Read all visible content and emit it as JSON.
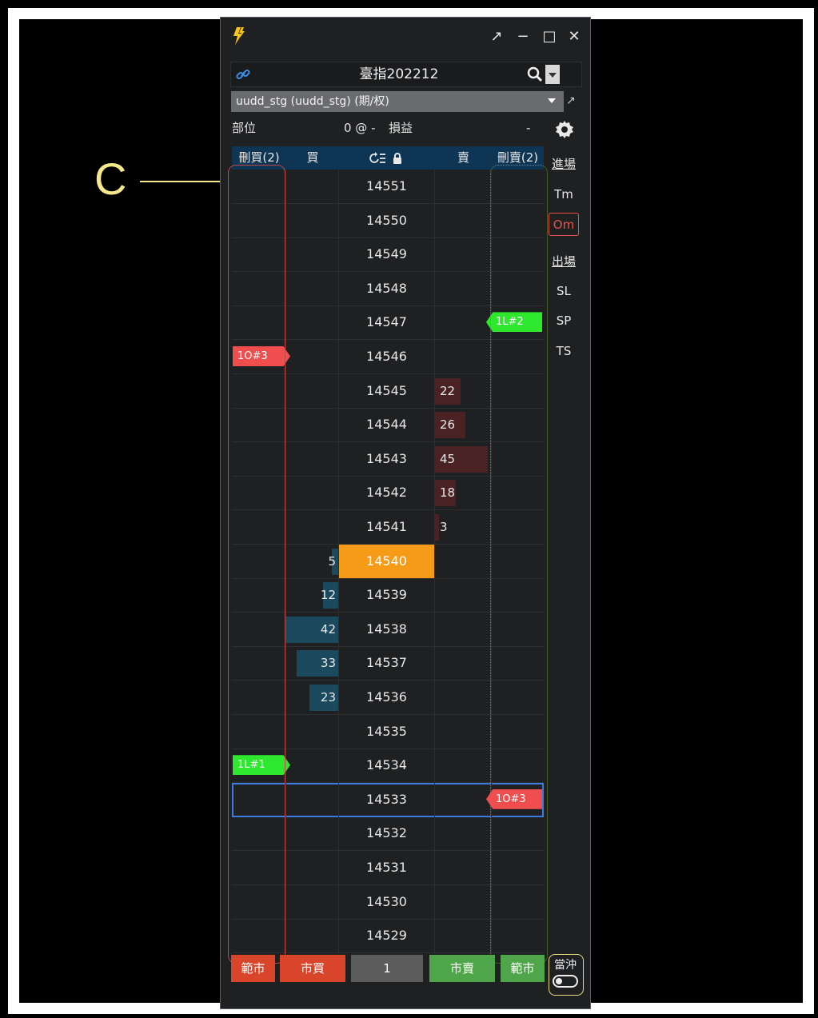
{
  "window": {
    "symbol": "臺指202212",
    "strategy": "uudd_stg (uudd_stg) (期/权)",
    "position_label": "部位",
    "position_value": "0 @ -",
    "pnl_label": "損益",
    "pnl_value": "-"
  },
  "header": {
    "del_buy": "刪買(2)",
    "buy": "買",
    "sell": "賣",
    "del_sell": "刪賣(2)"
  },
  "side_panel": {
    "entry": "進場",
    "tm": "Tm",
    "om": "Om",
    "exit": "出場",
    "sl": "SL",
    "sp": "SP",
    "ts": "TS"
  },
  "ladder": [
    {
      "price": "14551"
    },
    {
      "price": "14550"
    },
    {
      "price": "14549"
    },
    {
      "price": "14548"
    },
    {
      "price": "14547",
      "del_sell_tag": "1L#2"
    },
    {
      "price": "14546",
      "del_buy_tag": "1O#3"
    },
    {
      "price": "14545",
      "ask": "22"
    },
    {
      "price": "14544",
      "ask": "26"
    },
    {
      "price": "14543",
      "ask": "45"
    },
    {
      "price": "14542",
      "ask": "18"
    },
    {
      "price": "14541",
      "ask": "3"
    },
    {
      "price": "14540",
      "bid": "5"
    },
    {
      "price": "14539",
      "bid": "12"
    },
    {
      "price": "14538",
      "bid": "42"
    },
    {
      "price": "14537",
      "bid": "33"
    },
    {
      "price": "14536",
      "bid": "23"
    },
    {
      "price": "14535"
    },
    {
      "price": "14534",
      "del_buy_tag": "1L#1"
    },
    {
      "price": "14533",
      "del_sell_tag": "1O#3"
    },
    {
      "price": "14532"
    },
    {
      "price": "14531"
    },
    {
      "price": "14530"
    },
    {
      "price": "14529"
    }
  ],
  "footer": {
    "flatten_left": "範市",
    "market_buy": "市買",
    "quantity": "1",
    "market_sell": "市賣",
    "flatten_right": "範市",
    "hedge": "當沖"
  },
  "annotation": {
    "label": "C"
  },
  "colors": {
    "last_price": "#f59b18",
    "bid_bar": "#1b4a5e",
    "ask_bar": "#4a2224",
    "order_tag_red": "#f04e4e",
    "order_tag_green": "#2ee82e"
  }
}
